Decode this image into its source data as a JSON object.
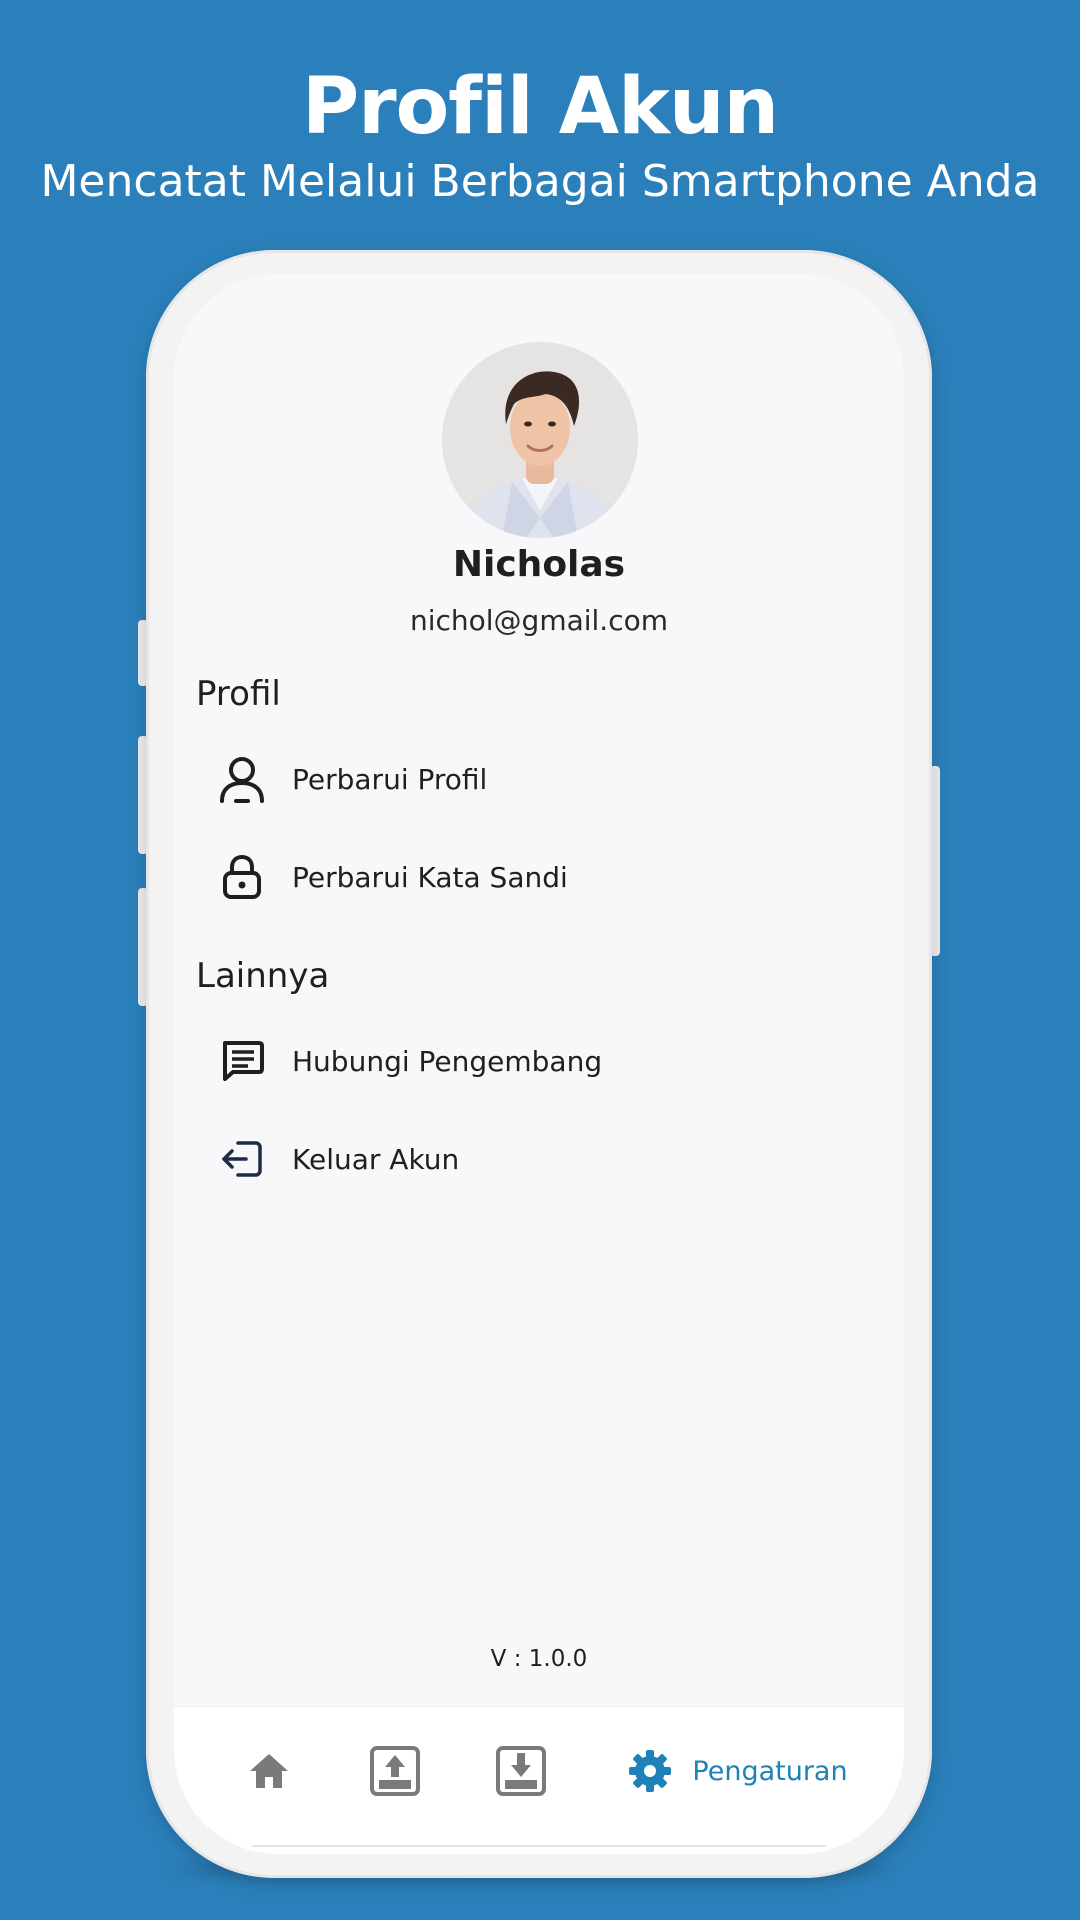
{
  "banner": {
    "title": "Profil Akun",
    "subtitle": "Mencatat Melalui Berbagai Smartphone Anda"
  },
  "profile": {
    "avatar_icon": "user-photo",
    "name": "Nicholas",
    "email": "nichol@gmail.com"
  },
  "sections": {
    "profile": {
      "title": "Profil",
      "items": [
        {
          "label": "Perbarui Profil",
          "icon": "person-icon"
        },
        {
          "label": "Perbarui Kata Sandi",
          "icon": "lock-icon"
        }
      ]
    },
    "other": {
      "title": "Lainnya",
      "items": [
        {
          "label": "Hubungi Pengembang",
          "icon": "message-icon"
        },
        {
          "label": "Keluar Akun",
          "icon": "logout-icon"
        }
      ]
    }
  },
  "version": "V : 1.0.0",
  "bottom_nav": {
    "items": [
      {
        "icon": "home-icon",
        "label": ""
      },
      {
        "icon": "upload-icon",
        "label": ""
      },
      {
        "icon": "download-icon",
        "label": ""
      },
      {
        "icon": "gear-icon",
        "label": "Pengaturan",
        "active": true
      }
    ]
  },
  "colors": {
    "background": "#2b80bb",
    "accent": "#1e82b8",
    "nav_inactive": "#7a7a7a"
  }
}
